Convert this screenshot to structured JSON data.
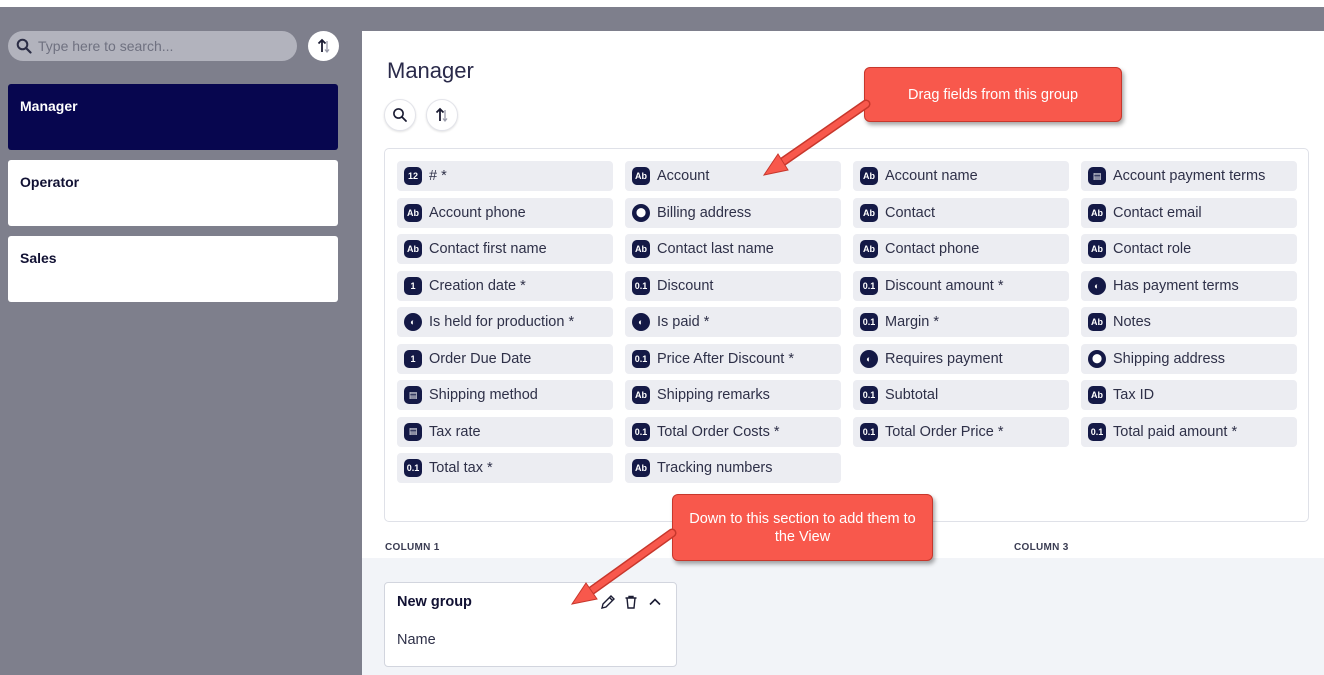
{
  "sidebar": {
    "search_placeholder": "Type here to search...",
    "roles": [
      "Manager",
      "Operator",
      "Sales"
    ]
  },
  "main": {
    "title": "Manager",
    "fields": [
      {
        "label": "# *",
        "icon": "number-icon",
        "glyph": "12"
      },
      {
        "label": "Account",
        "icon": "text-icon",
        "glyph": "Ab"
      },
      {
        "label": "Account name",
        "icon": "text-icon",
        "glyph": "Ab"
      },
      {
        "label": "Account payment terms",
        "icon": "select-icon",
        "glyph": "▤"
      },
      {
        "label": "Account phone",
        "icon": "text-icon",
        "glyph": "Ab"
      },
      {
        "label": "Billing address",
        "icon": "location-icon",
        "glyph": "⬤"
      },
      {
        "label": "Contact",
        "icon": "text-icon",
        "glyph": "Ab"
      },
      {
        "label": "Contact email",
        "icon": "text-icon",
        "glyph": "Ab"
      },
      {
        "label": "Contact first name",
        "icon": "text-icon",
        "glyph": "Ab"
      },
      {
        "label": "Contact last name",
        "icon": "text-icon",
        "glyph": "Ab"
      },
      {
        "label": "Contact phone",
        "icon": "text-icon",
        "glyph": "Ab"
      },
      {
        "label": "Contact role",
        "icon": "text-icon",
        "glyph": "Ab"
      },
      {
        "label": "Creation date *",
        "icon": "date-icon",
        "glyph": "1"
      },
      {
        "label": "Discount",
        "icon": "decimal-icon",
        "glyph": "0.1"
      },
      {
        "label": "Discount amount *",
        "icon": "decimal-icon",
        "glyph": "0.1"
      },
      {
        "label": "Has payment terms",
        "icon": "toggle-icon",
        "glyph": "◐"
      },
      {
        "label": "Is held for production *",
        "icon": "toggle-icon",
        "glyph": "◐"
      },
      {
        "label": "Is paid *",
        "icon": "toggle-icon",
        "glyph": "◐"
      },
      {
        "label": "Margin *",
        "icon": "decimal-icon",
        "glyph": "0.1"
      },
      {
        "label": "Notes",
        "icon": "text-icon",
        "glyph": "Ab"
      },
      {
        "label": "Order Due Date",
        "icon": "date-icon",
        "glyph": "1"
      },
      {
        "label": "Price After Discount *",
        "icon": "decimal-icon",
        "glyph": "0.1"
      },
      {
        "label": "Requires payment",
        "icon": "toggle-icon",
        "glyph": "◐"
      },
      {
        "label": "Shipping address",
        "icon": "location-icon",
        "glyph": "⬤"
      },
      {
        "label": "Shipping method",
        "icon": "select-icon",
        "glyph": "▤"
      },
      {
        "label": "Shipping remarks",
        "icon": "text-icon",
        "glyph": "Ab"
      },
      {
        "label": "Subtotal",
        "icon": "decimal-icon",
        "glyph": "0.1"
      },
      {
        "label": "Tax ID",
        "icon": "text-icon",
        "glyph": "Ab"
      },
      {
        "label": "Tax rate",
        "icon": "select-icon",
        "glyph": "▤"
      },
      {
        "label": "Total Order Costs *",
        "icon": "decimal-icon",
        "glyph": "0.1"
      },
      {
        "label": "Total Order Price *",
        "icon": "decimal-icon",
        "glyph": "0.1"
      },
      {
        "label": "Total paid amount *",
        "icon": "decimal-icon",
        "glyph": "0.1"
      },
      {
        "label": "Total tax *",
        "icon": "decimal-icon",
        "glyph": "0.1"
      },
      {
        "label": "Tracking numbers",
        "icon": "text-icon",
        "glyph": "Ab"
      }
    ],
    "columns": [
      "COLUMN 1",
      "COLUMN 3"
    ],
    "group": {
      "title": "New group",
      "field": "Name"
    }
  },
  "callouts": {
    "drag": "Drag fields from this group",
    "drop": "Down to this section to add them to the View"
  },
  "colors": {
    "active_role": "#07064f",
    "callout": "#f8584c",
    "sidebar": "#7e7f8c"
  }
}
